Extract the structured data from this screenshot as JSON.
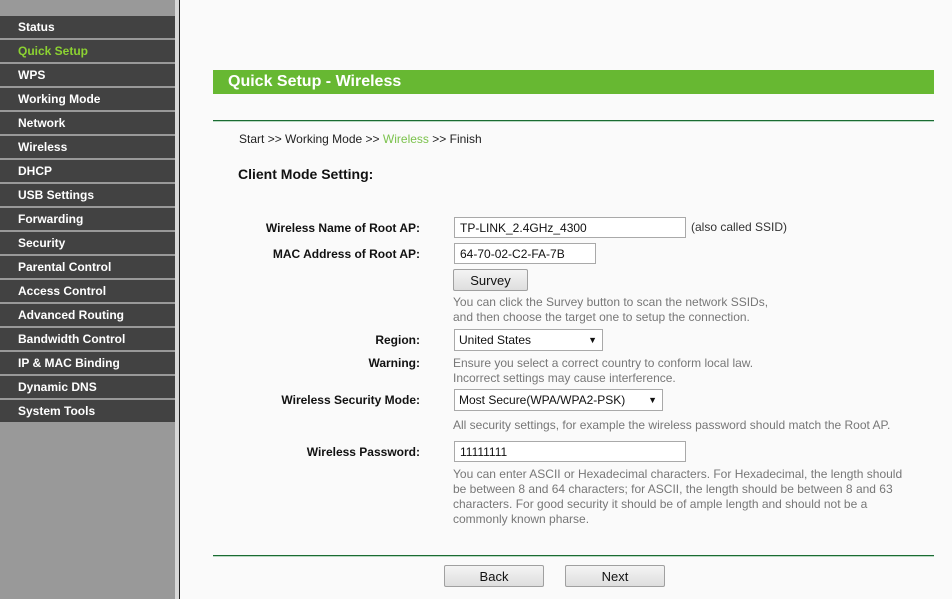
{
  "sidebar": {
    "active_index": 1,
    "items": [
      {
        "label": "Status"
      },
      {
        "label": "Quick Setup"
      },
      {
        "label": "WPS"
      },
      {
        "label": "Working Mode"
      },
      {
        "label": "Network"
      },
      {
        "label": "Wireless"
      },
      {
        "label": "DHCP"
      },
      {
        "label": "USB Settings"
      },
      {
        "label": "Forwarding"
      },
      {
        "label": "Security"
      },
      {
        "label": "Parental Control"
      },
      {
        "label": "Access Control"
      },
      {
        "label": "Advanced Routing"
      },
      {
        "label": "Bandwidth Control"
      },
      {
        "label": "IP & MAC Binding"
      },
      {
        "label": "Dynamic DNS"
      },
      {
        "label": "System Tools"
      }
    ]
  },
  "header": {
    "title": "Quick Setup - Wireless"
  },
  "breadcrumb": {
    "steps": [
      "Start",
      "Working Mode",
      "Wireless",
      "Finish"
    ],
    "separator": ">>",
    "current": "Wireless"
  },
  "section_title": "Client Mode Setting:",
  "form": {
    "ssid": {
      "label": "Wireless Name of Root AP:",
      "value": "TP-LINK_2.4GHz_4300",
      "note": "(also called SSID)"
    },
    "mac": {
      "label": "MAC Address of Root AP:",
      "value": "64-70-02-C2-FA-7B"
    },
    "survey": {
      "button": "Survey",
      "help_line1": "You can click the Survey button to scan the network SSIDs,",
      "help_line2": "and then choose the target one to setup the connection."
    },
    "region": {
      "label": "Region:",
      "value": "United States"
    },
    "warning": {
      "label": "Warning:",
      "line1": "Ensure you select a correct country to conform local law.",
      "line2": "Incorrect settings may cause interference."
    },
    "security_mode": {
      "label": "Wireless Security Mode:",
      "value": "Most Secure(WPA/WPA2-PSK)",
      "help": "All security settings, for example the wireless password should match the Root AP."
    },
    "password": {
      "label": "Wireless Password:",
      "value": "11111111",
      "help_lines": [
        "You can enter ASCII or Hexadecimal characters. For Hexadecimal, the length should",
        "be between 8 and 64 characters; for ASCII, the length should be between 8 and 63",
        "characters. For good security it should be of ample length and should not be a",
        "commonly known pharse."
      ]
    }
  },
  "footer": {
    "back": "Back",
    "next": "Next"
  },
  "colors": {
    "accent_green": "#67b832",
    "active_menu": "#8cd232",
    "sidebar_bg": "#424242"
  }
}
